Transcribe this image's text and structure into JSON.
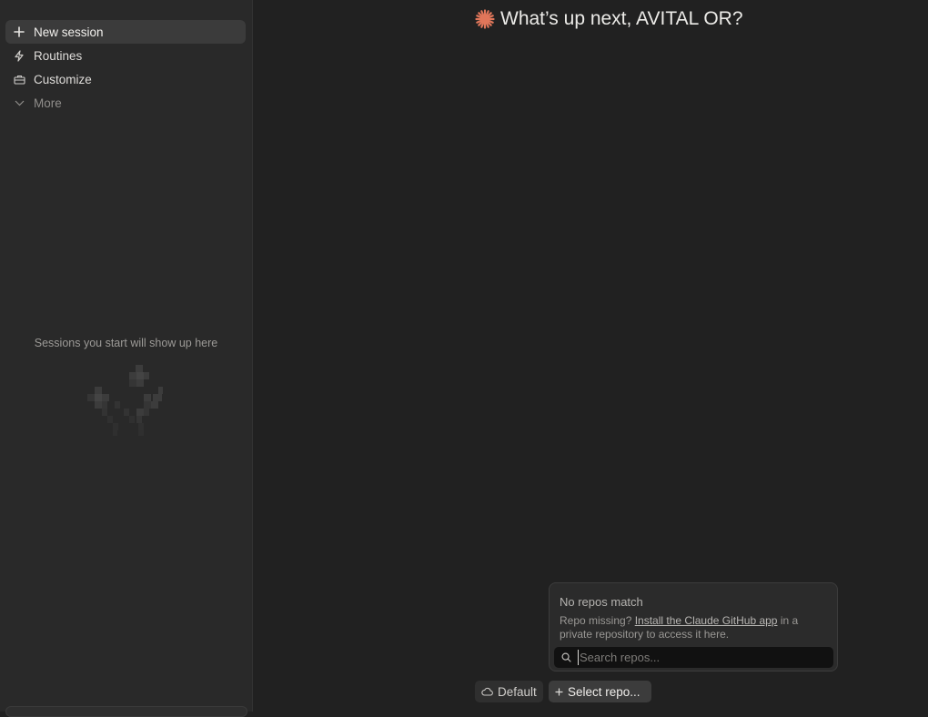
{
  "sidebar": {
    "items": [
      {
        "label": "New session",
        "icon": "plus-icon"
      },
      {
        "label": "Routines",
        "icon": "lightning-icon"
      },
      {
        "label": "Customize",
        "icon": "briefcase-icon"
      },
      {
        "label": "More",
        "icon": "chevron-down-icon"
      }
    ],
    "empty_state": "Sessions you start will show up here"
  },
  "main": {
    "greeting": "What’s up next, AVITAL OR?",
    "accent_color": "#e0765a"
  },
  "repo_popover": {
    "title": "No repos match",
    "help_prefix": "Repo missing? ",
    "help_link": "Install the Claude GitHub app",
    "help_suffix": " in a private repository to access it here.",
    "search_placeholder": "Search repos..."
  },
  "composer": {
    "environment_label": "Default",
    "repo_label": "Select repo..."
  }
}
